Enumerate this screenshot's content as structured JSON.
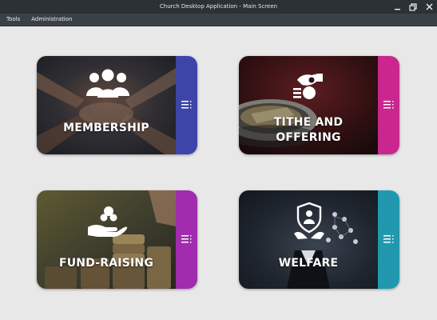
{
  "window": {
    "title": "Church Desktop Application - Main Screen",
    "controls": [
      "minimize-icon",
      "restore-icon",
      "close-icon"
    ]
  },
  "menubar": {
    "items": [
      {
        "label": "Tools"
      },
      {
        "label": "Administration"
      }
    ]
  },
  "cards": [
    {
      "id": "membership",
      "lines": [
        "MEMBERSHIP"
      ],
      "accent": "#3d45a8",
      "icon": "people-group-icon",
      "menu_icon": "list-menu-icon"
    },
    {
      "id": "tithe",
      "lines": [
        "TITHE AND",
        "OFFERING"
      ],
      "accent": "#c9278e",
      "icon": "hand-money-icon",
      "menu_icon": "list-menu-icon"
    },
    {
      "id": "fundraising",
      "lines": [
        "FUND-RAISING"
      ],
      "accent": "#a12cae",
      "icon": "hand-giving-icon",
      "menu_icon": "list-menu-icon"
    },
    {
      "id": "welfare",
      "lines": [
        "WELFARE"
      ],
      "accent": "#2298ae",
      "icon": "shield-care-icon",
      "menu_icon": "list-menu-icon"
    }
  ]
}
